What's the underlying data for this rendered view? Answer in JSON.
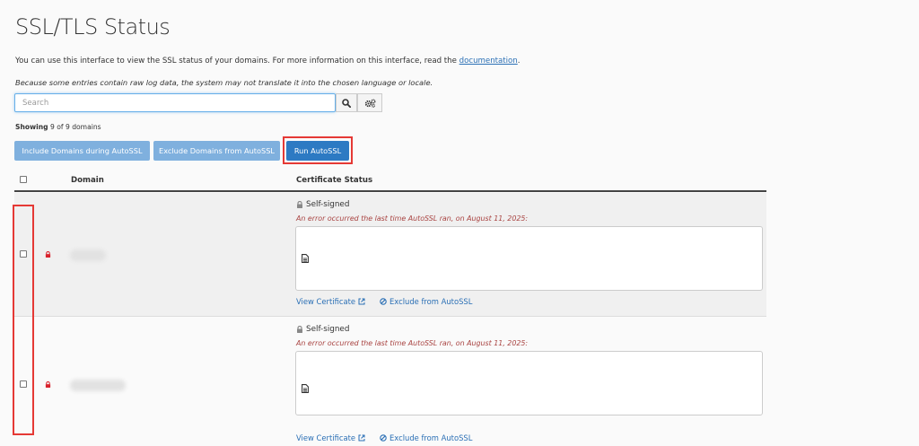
{
  "page": {
    "title": "SSL/TLS Status",
    "intro": "You can use this interface to view the SSL status of your domains. For more information on this interface, read the",
    "intro_link": "documentation",
    "intro_end": ".",
    "note": "Because some entries contain raw log data, the system may not translate it into the chosen language or locale."
  },
  "search": {
    "placeholder": "Search",
    "value": ""
  },
  "showing": {
    "label": "Showing",
    "text": "9 of 9 domains"
  },
  "toolbar": {
    "include_label": "Include Domains during AutoSSL",
    "exclude_label": "Exclude Domains from AutoSSL",
    "run_label": "Run AutoSSL"
  },
  "table": {
    "columns": {
      "domain": "Domain",
      "status": "Certificate Status"
    },
    "rows": [
      {
        "status": "Self-signed",
        "error": "An error occurred the last time AutoSSL ran, on August 11, 2025:",
        "view_label": "View Certificate",
        "exclude_label": "Exclude from AutoSSL"
      },
      {
        "status": "Self-signed",
        "error": "An error occurred the last time AutoSSL ran, on August 11, 2025:",
        "view_label": "View Certificate",
        "exclude_label": "Exclude from AutoSSL"
      }
    ]
  },
  "colors": {
    "accent": "#2d7ac3",
    "button_light": "#7fb0de",
    "error": "#a94442",
    "highlight": "#e53935",
    "lock": "#d9232d"
  },
  "icons": [
    "search-icon",
    "gears-icon",
    "lock-icon",
    "document-icon",
    "external-link-icon",
    "ban-icon"
  ]
}
